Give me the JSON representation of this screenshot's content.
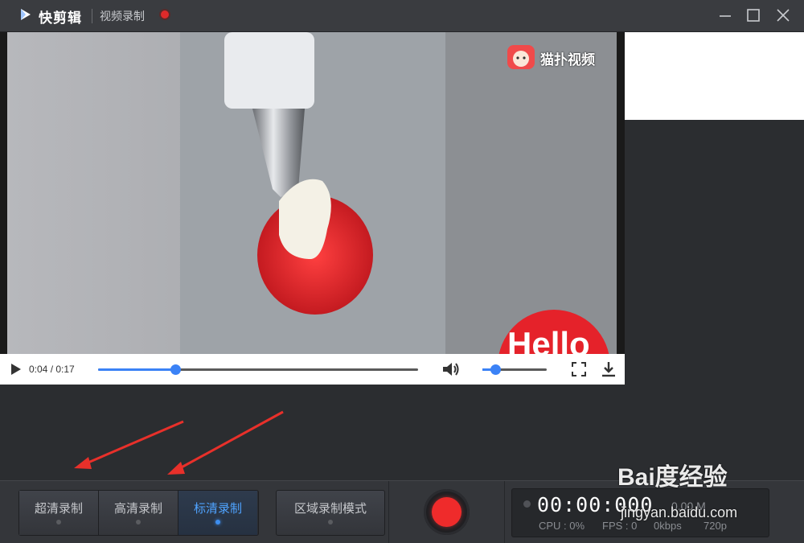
{
  "titlebar": {
    "app_name": "快剪辑",
    "mode_title": "视频录制"
  },
  "video": {
    "overlay_brand": "猫扑视频",
    "sticker_text": "Hello",
    "current_time": "0:04",
    "duration": "0:17",
    "time_display": "0:04 / 0:17",
    "progress": 0.24,
    "volume": 0.2
  },
  "quality": {
    "items": [
      {
        "label": "超清录制",
        "active": false
      },
      {
        "label": "高清录制",
        "active": false
      },
      {
        "label": "标清录制",
        "active": true
      }
    ],
    "region_label": "区域录制模式"
  },
  "stats": {
    "timer": "00:00:000",
    "size": "0.00 M",
    "cpu": "CPU : 0%",
    "fps": "FPS : 0",
    "bitrate": "0kbps",
    "resolution": "720p"
  },
  "watermark": {
    "logo": "Bai度经验",
    "url": "jingyan.baidu.com"
  },
  "colors": {
    "accent": "#3b82f6",
    "record": "#ef2b2b",
    "active_text": "#4fa3ff"
  }
}
